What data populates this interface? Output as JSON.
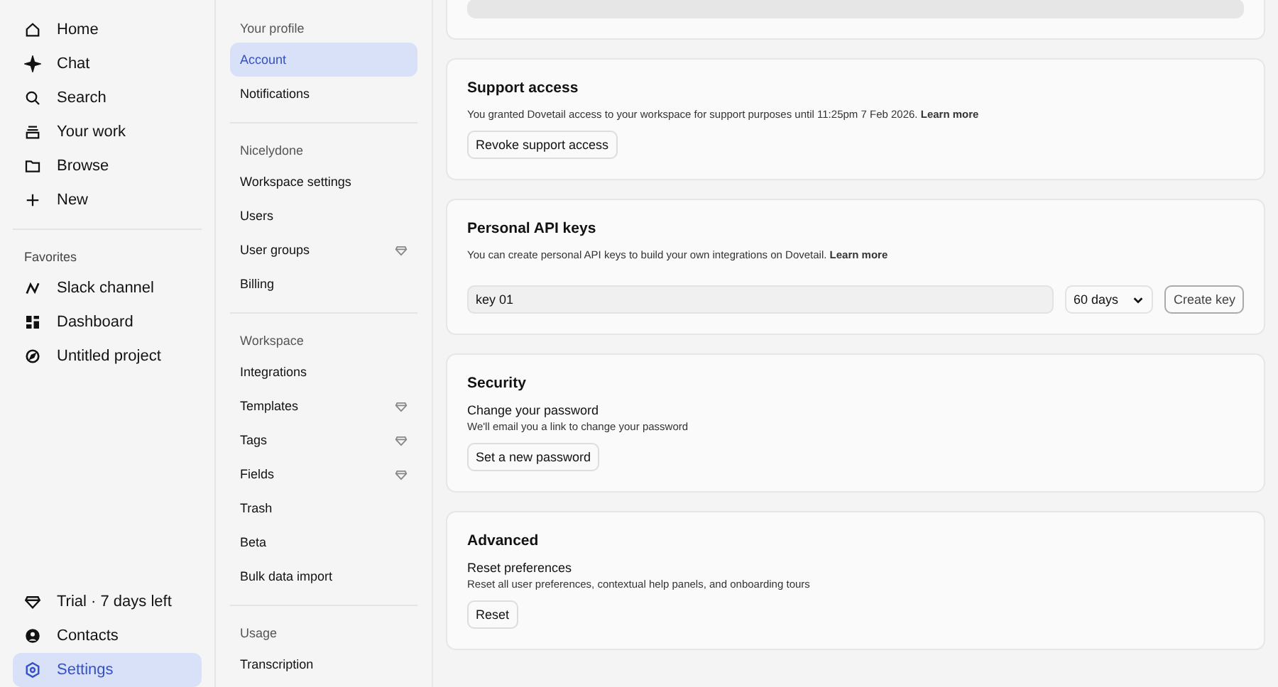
{
  "sidebar": {
    "items": [
      {
        "label": "Home"
      },
      {
        "label": "Chat"
      },
      {
        "label": "Search"
      },
      {
        "label": "Your work"
      },
      {
        "label": "Browse"
      },
      {
        "label": "New"
      }
    ],
    "favorites_heading": "Favorites",
    "favorites": [
      {
        "label": "Slack channel"
      },
      {
        "label": "Dashboard"
      },
      {
        "label": "Untitled project"
      }
    ],
    "bottom_items": [
      {
        "label": "Trial · 7 days left",
        "selected": false
      },
      {
        "label": "Contacts",
        "selected": false
      },
      {
        "label": "Settings",
        "selected": true
      }
    ]
  },
  "settings_nav": [
    {
      "heading": "Your profile",
      "items": [
        {
          "label": "Account",
          "selected": true,
          "premium": false
        },
        {
          "label": "Notifications",
          "selected": false,
          "premium": false
        }
      ]
    },
    {
      "heading": "Nicelydone",
      "items": [
        {
          "label": "Workspace settings",
          "selected": false,
          "premium": false
        },
        {
          "label": "Users",
          "selected": false,
          "premium": false
        },
        {
          "label": "User groups",
          "selected": false,
          "premium": true
        },
        {
          "label": "Billing",
          "selected": false,
          "premium": false
        }
      ]
    },
    {
      "heading": "Workspace",
      "items": [
        {
          "label": "Integrations",
          "selected": false,
          "premium": false
        },
        {
          "label": "Templates",
          "selected": false,
          "premium": true
        },
        {
          "label": "Tags",
          "selected": false,
          "premium": true
        },
        {
          "label": "Fields",
          "selected": false,
          "premium": true
        },
        {
          "label": "Trash",
          "selected": false,
          "premium": false
        },
        {
          "label": "Beta",
          "selected": false,
          "premium": false
        },
        {
          "label": "Bulk data import",
          "selected": false,
          "premium": false
        }
      ]
    },
    {
      "heading": "Usage",
      "items": [
        {
          "label": "Transcription",
          "selected": false,
          "premium": false
        }
      ]
    }
  ],
  "cards": [
    {
      "kind": "support",
      "title": "Support access",
      "description": "You granted Dovetail access to your workspace for support purposes until 11:25pm 7 Feb 2026. **Learn more**",
      "button": "Revoke support access"
    },
    {
      "kind": "api",
      "title": "Personal API keys",
      "description": "You can create personal API keys to build your own integrations on Dovetail. **Learn more**",
      "key_name": "key 01",
      "expiry": "60 days",
      "button": "Create key"
    },
    {
      "kind": "action",
      "title": "Security",
      "subtitle": "Change your password",
      "description": "We'll email you a link to change your password",
      "button": "Set a new password"
    },
    {
      "kind": "action",
      "title": "Advanced",
      "subtitle": "Reset preferences",
      "description": "Reset all user preferences, contextual help panels, and onboarding tours",
      "button": "Reset"
    }
  ]
}
